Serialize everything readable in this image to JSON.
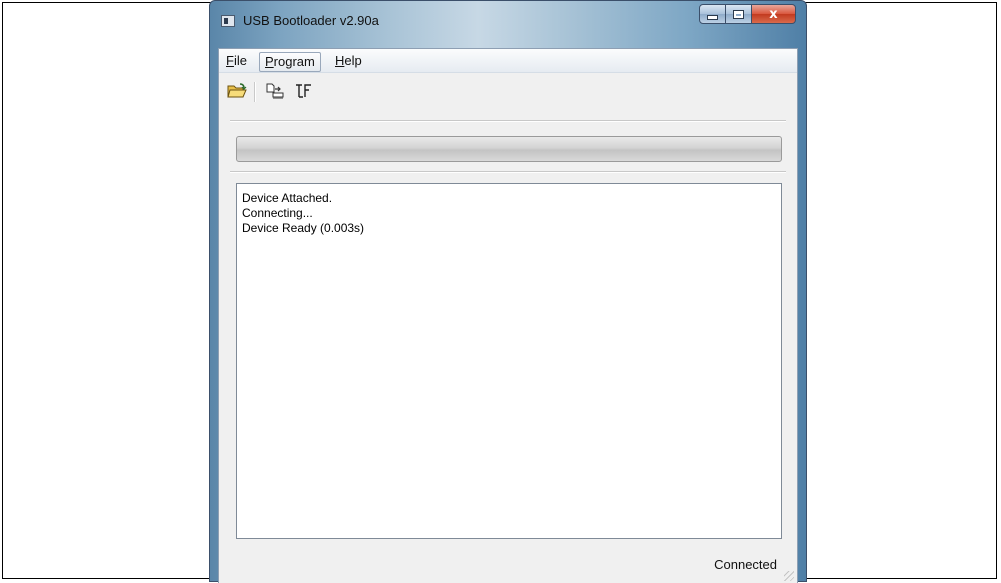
{
  "window": {
    "title": "USB Bootloader v2.90a",
    "close_glyph": "x"
  },
  "menu": {
    "file_mnemonic": "F",
    "file_rest": "ile",
    "program_mnemonic": "P",
    "program_rest": "rogram",
    "help_mnemonic": "H",
    "help_rest": "elp"
  },
  "toolbar": {
    "icons": [
      "open-folder-icon",
      "write-device-icon",
      "reset-device-icon"
    ]
  },
  "progress": {
    "value_percent": 0
  },
  "log": {
    "lines": [
      "Device Attached.",
      "Connecting...",
      "Device Ready (0.003s)"
    ]
  },
  "status": {
    "text": "Connected"
  },
  "colors": {
    "close_button": "#d9573d",
    "accent": "#7da4c1"
  }
}
